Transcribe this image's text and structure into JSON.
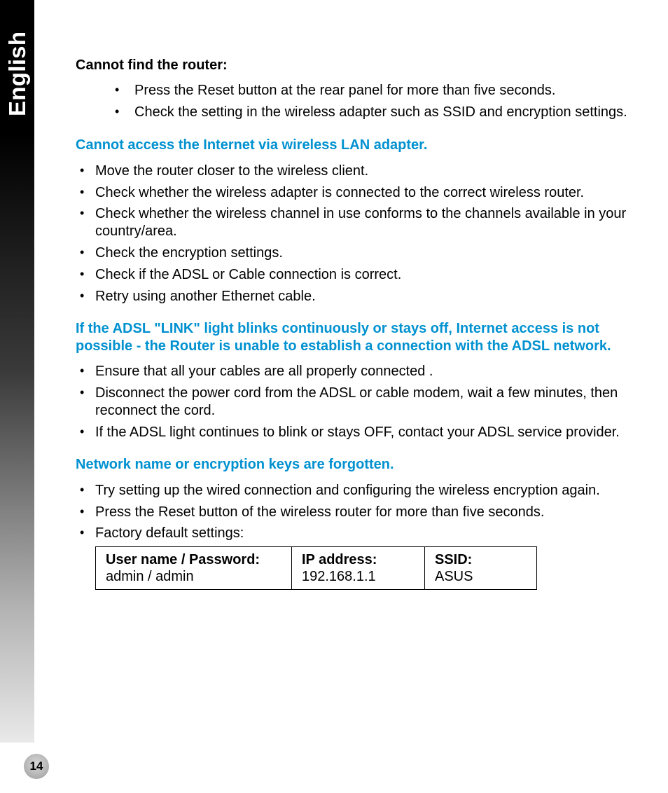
{
  "side_label": "English",
  "page_number": "14",
  "sec1": {
    "heading": "Cannot find the router:",
    "items": [
      "Press the Reset button at the rear panel for more than five seconds.",
      "Check the setting in the wireless adapter such as SSID and encryption settings."
    ]
  },
  "sec2": {
    "heading": "Cannot access the Internet via wireless LAN adapter.",
    "items": [
      "Move the router closer to the wireless client.",
      "Check whether the wireless adapter is connected to the correct wireless router.",
      "Check whether the wireless channel in use conforms to the channels available in your country/area.",
      "Check the encryption settings.",
      "Check if the ADSL or Cable connection is correct.",
      "Retry using another Ethernet cable."
    ]
  },
  "sec3": {
    "heading": "If the ADSL \"LINK\" light blinks continuously or stays off, Internet access is not possible - the Router is unable to establish a connection with the ADSL network.",
    "items": [
      "Ensure that all your cables are all properly connected .",
      "Disconnect the power cord from the ADSL or cable modem, wait a few minutes, then reconnect the cord.",
      "If the ADSL light continues to blink or stays OFF, contact your ADSL service provider."
    ]
  },
  "sec4": {
    "heading": "Network name or encryption keys are forgotten.",
    "items": [
      "Try setting up the wired connection and configuring the wireless encryption again.",
      "Press the Reset button of the wireless router for more than five seconds.",
      "Factory default settings:"
    ]
  },
  "table": {
    "c1_label": "User name / Password:",
    "c1_value": "admin / admin",
    "c2_label": "IP address:",
    "c2_value": "192.168.1.1",
    "c3_label": "SSID:",
    "c3_value": "ASUS"
  }
}
